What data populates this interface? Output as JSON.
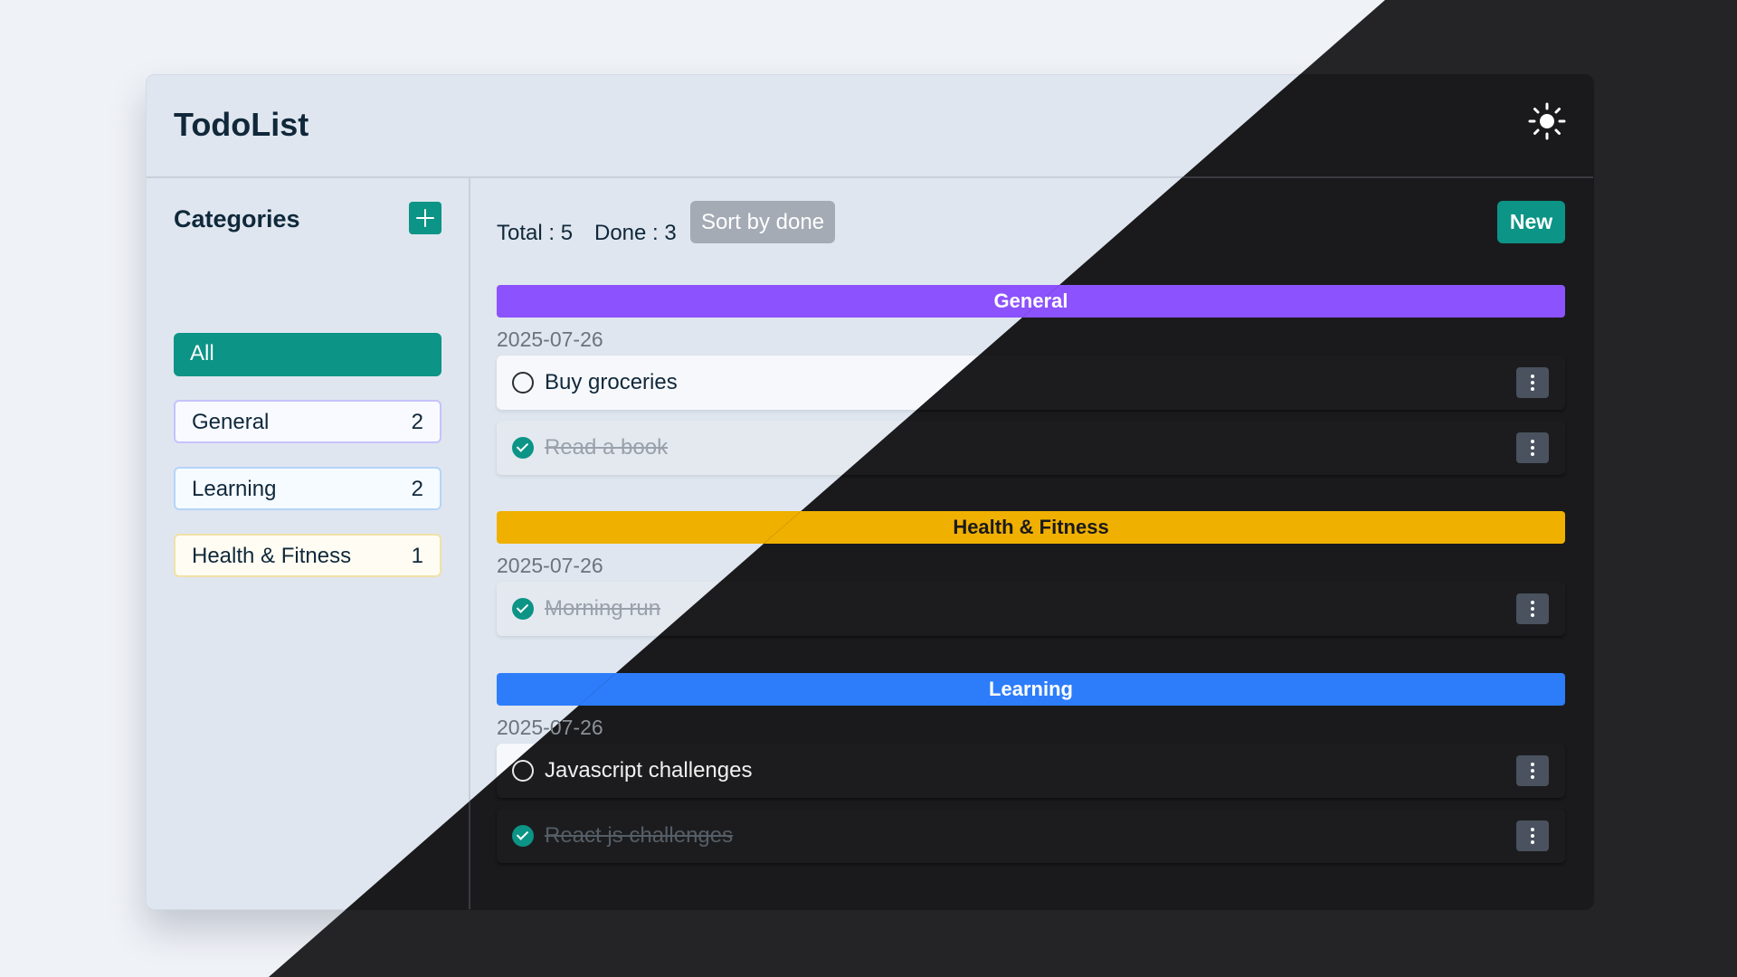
{
  "app": {
    "title": "TodoList",
    "theme_toggle_icon": "sun-icon"
  },
  "colors": {
    "accent": "#0c9486",
    "general": "#8c52fd",
    "health_fitness": "#f0b000",
    "learning": "#2d7dfb",
    "sort_button": "#a4abb5",
    "menu_button": "#49525e",
    "light_background": "#eff2f7",
    "dark_background": "#1a1a1c"
  },
  "sidebar": {
    "title": "Categories",
    "add_icon": "plus-icon",
    "items": [
      {
        "label": "All",
        "count": ""
      },
      {
        "label": "General",
        "count": "2"
      },
      {
        "label": "Learning",
        "count": "2"
      },
      {
        "label": "Health & Fitness",
        "count": "1"
      }
    ]
  },
  "toolbar": {
    "total": "Total : 5",
    "done": "Done : 3",
    "sort_label": "Sort by done",
    "new_label": "New"
  },
  "groups": [
    {
      "name": "General",
      "date": "2025-07-26",
      "tasks": [
        {
          "text": "Buy groceries",
          "done": false
        },
        {
          "text": "Read a book",
          "done": true
        }
      ]
    },
    {
      "name": "Health & Fitness",
      "date": "2025-07-26",
      "tasks": [
        {
          "text": "Morning run",
          "done": true
        }
      ]
    },
    {
      "name": "Learning",
      "date": "2025-07-26",
      "tasks": [
        {
          "text": "Javascript challenges",
          "done": false
        },
        {
          "text": "React js challenges",
          "done": true
        }
      ]
    }
  ],
  "task_menu_icon": "more-vertical-icon"
}
